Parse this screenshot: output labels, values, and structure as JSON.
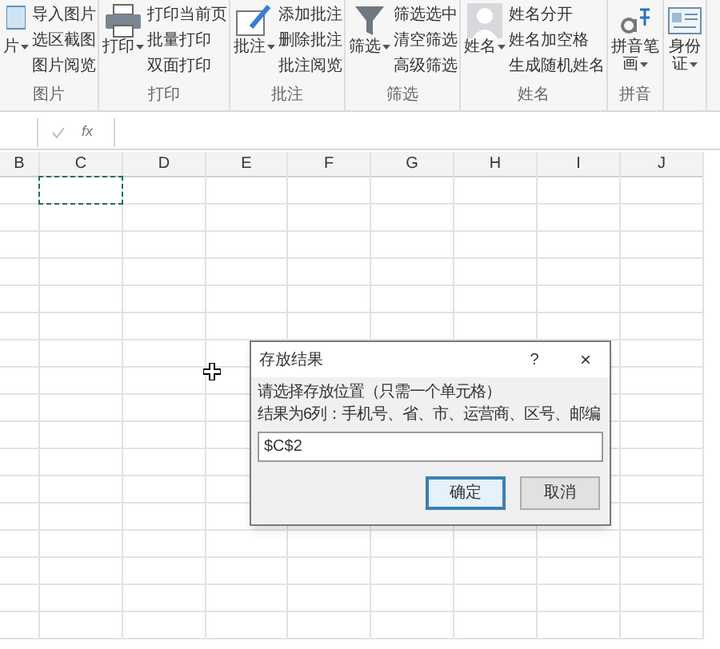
{
  "ribbon": {
    "groups": [
      {
        "label": "图片",
        "large": {
          "kind": "picture",
          "lines": [
            "片"
          ],
          "dropdown": true
        },
        "items": [
          "导入图片",
          "选区截图",
          "图片阅览"
        ]
      },
      {
        "label": "打印",
        "large": {
          "kind": "printer",
          "lines": [
            "打印"
          ],
          "dropdown": true
        },
        "items": [
          "打印当前页",
          "批量打印",
          "双面打印"
        ]
      },
      {
        "label": "批注",
        "large": {
          "kind": "note",
          "lines": [
            "批注"
          ],
          "dropdown": true
        },
        "items": [
          "添加批注",
          "删除批注",
          "批注阅览"
        ]
      },
      {
        "label": "筛选",
        "large": {
          "kind": "filter",
          "lines": [
            "筛选"
          ],
          "dropdown": true
        },
        "items": [
          "筛选选中",
          "清空筛选",
          "高级筛选"
        ]
      },
      {
        "label": "姓名",
        "large": {
          "kind": "person",
          "lines": [
            "姓名"
          ],
          "dropdown": true
        },
        "items": [
          "姓名分开",
          "姓名加空格",
          "生成随机姓名"
        ]
      },
      {
        "label": "拼音",
        "large": {
          "kind": "pinyin",
          "lines": [
            "拼音笔",
            "画"
          ],
          "dropdown": true
        }
      },
      {
        "large": {
          "kind": "idcard",
          "lines": [
            "身份",
            "证"
          ],
          "dropdown": true
        }
      }
    ]
  },
  "formula_bar": {
    "fx": "fx"
  },
  "sheet": {
    "columns": [
      {
        "label": "B",
        "marquee": false
      },
      {
        "label": "C",
        "marquee": true
      },
      {
        "label": "D",
        "marquee": false
      },
      {
        "label": "E",
        "marquee": false
      },
      {
        "label": "F",
        "marquee": false
      },
      {
        "label": "G",
        "marquee": false
      },
      {
        "label": "H",
        "marquee": false
      },
      {
        "label": "I",
        "marquee": false
      },
      {
        "label": "J",
        "marquee": false
      }
    ]
  },
  "dialog": {
    "title": "存放结果",
    "help": "?",
    "close": "×",
    "lines": [
      "请选择存放位置（只需一个单元格）",
      "结果为6列：手机号、省、市、运营商、区号、邮编"
    ],
    "value": "$C$2",
    "buttons": [
      {
        "label": "确定",
        "default": true
      },
      {
        "label": "取消",
        "default": false
      }
    ]
  }
}
